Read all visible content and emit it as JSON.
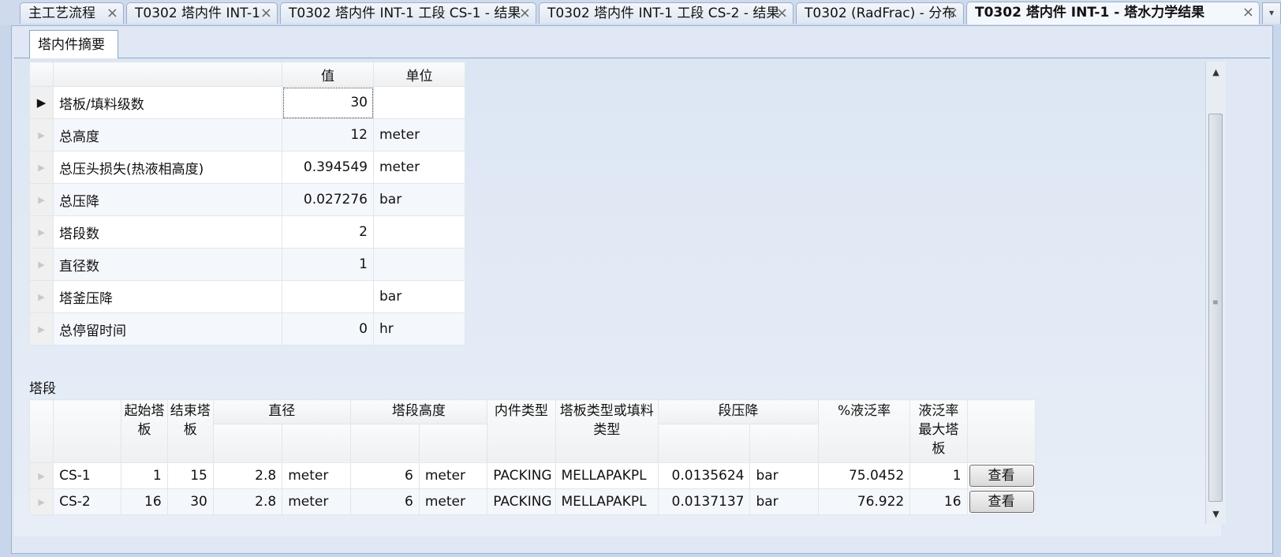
{
  "tabs": [
    {
      "label": "主工艺流程"
    },
    {
      "label": "T0302 塔内件 INT-1"
    },
    {
      "label": "T0302 塔内件 INT-1 工段 CS-1 - 结果"
    },
    {
      "label": "T0302 塔内件 INT-1 工段 CS-2 - 结果"
    },
    {
      "label": "T0302 (RadFrac) - 分布"
    },
    {
      "label": "T0302 塔内件 INT-1 - 塔水力学结果"
    }
  ],
  "subtab": "塔内件摘要",
  "summary": {
    "headers": {
      "value": "值",
      "unit": "单位"
    },
    "rows": [
      {
        "label": "塔板/填料级数",
        "value": "30",
        "unit": ""
      },
      {
        "label": "总高度",
        "value": "12",
        "unit": "meter"
      },
      {
        "label": "总压头损失(热液相高度)",
        "value": "0.394549",
        "unit": "meter"
      },
      {
        "label": "总压降",
        "value": "0.027276",
        "unit": "bar"
      },
      {
        "label": "塔段数",
        "value": "2",
        "unit": ""
      },
      {
        "label": "直径数",
        "value": "1",
        "unit": ""
      },
      {
        "label": "塔釜压降",
        "value": "",
        "unit": "bar"
      },
      {
        "label": "总停留时间",
        "value": "0",
        "unit": "hr"
      }
    ]
  },
  "sections": {
    "title": "塔段",
    "headers": {
      "start": "起始塔板",
      "end": "结束塔板",
      "diameter": "直径",
      "height": "塔段高度",
      "internal_type": "内件类型",
      "tray_type": "塔板类型或填料类型",
      "dp": "段压降",
      "flood": "%液泛率",
      "max_flood": "液泛率最大塔板"
    },
    "rows": [
      {
        "name": "CS-1",
        "start": "1",
        "end": "15",
        "diameter": "2.8",
        "diameter_unit": "meter",
        "height": "6",
        "height_unit": "meter",
        "internal_type": "PACKING",
        "tray_type": "MELLAPAKPL",
        "dp": "0.0135624",
        "dp_unit": "bar",
        "flood": "75.0452",
        "max_flood": "1",
        "button": "查看"
      },
      {
        "name": "CS-2",
        "start": "16",
        "end": "30",
        "diameter": "2.8",
        "diameter_unit": "meter",
        "height": "6",
        "height_unit": "meter",
        "internal_type": "PACKING",
        "tray_type": "MELLAPAKPL",
        "dp": "0.0137137",
        "dp_unit": "bar",
        "flood": "76.922",
        "max_flood": "16",
        "button": "查看"
      }
    ]
  },
  "icons": {
    "close": "close-icon",
    "row_pointer": "row-pointer-icon",
    "scroll_up": "scroll-up-icon",
    "scroll_down": "scroll-down-icon"
  }
}
